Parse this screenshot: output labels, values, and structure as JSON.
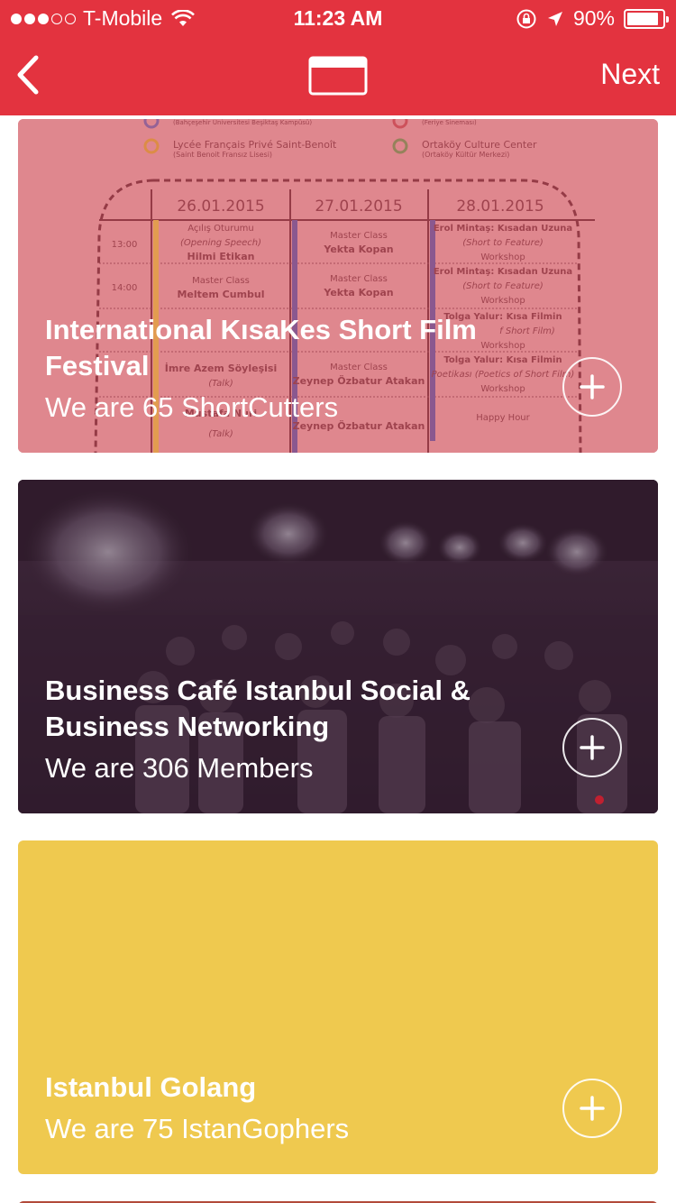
{
  "status_bar": {
    "carrier": "T-Mobile",
    "time": "11:23 AM",
    "battery": "90%",
    "battery_level": 0.9
  },
  "nav": {
    "next_label": "Next"
  },
  "cards": [
    {
      "title": "International KısaKes Short Film Festival",
      "subtitle": "We are 65 ShortCutters",
      "image": {
        "venues": [
          "Lycée Français Privé Saint-Benoît",
          "(Saint Benoit Fransız Lisesi)",
          "Ortaköy Culture Center",
          "(Ortaköy Kültür Merkezi)",
          "(Bahçeşehir Üniversitesi Beşiktaş Kampüsü)",
          "(Feriye Sineması)"
        ],
        "dates": [
          "26.01.2015",
          "27.01.2015",
          "28.01.2015"
        ],
        "times": [
          "13:00",
          "14:00"
        ],
        "col1": [
          "Açılış Oturumu",
          "(Opening Speech)",
          "Hilmi Etikan",
          "Master Class",
          "Meltem Cumbul",
          "İmre Azem Söyleşisi",
          "(Talk)",
          "Mustafa Nuri",
          "(Talk)"
        ],
        "col2": [
          "Master Class",
          "Yekta Kopan",
          "Master Class",
          "Yekta Kopan",
          "Master Class",
          "Zeynep Özbatur Atakan",
          "Zeynep Özbatur Atakan"
        ],
        "col3": [
          "Erol Mintaş: Kısadan Uzuna",
          "(Short to Feature)",
          "Workshop",
          "Erol Mintaş: Kısadan Uzuna",
          "(Short to Feature)",
          "Workshop",
          "Tolga Yalur: Kısa Filmin",
          "f Short Film)",
          "Workshop",
          "Tolga Yalur: Kısa Filmin",
          "Poetikası (Poetics of Short Film)",
          "Workshop",
          "Happy Hour"
        ]
      }
    },
    {
      "title": "Business Café Istanbul Social & Business Networking",
      "subtitle": "We are 306 Members"
    },
    {
      "title": "Istanbul Golang",
      "subtitle": "We are 75 IstanGophers"
    }
  ],
  "colors": {
    "header": "#e3333f",
    "card1_tint": "#d98c91",
    "card2_tint": "#3a2636",
    "card3": "#efc94f"
  }
}
